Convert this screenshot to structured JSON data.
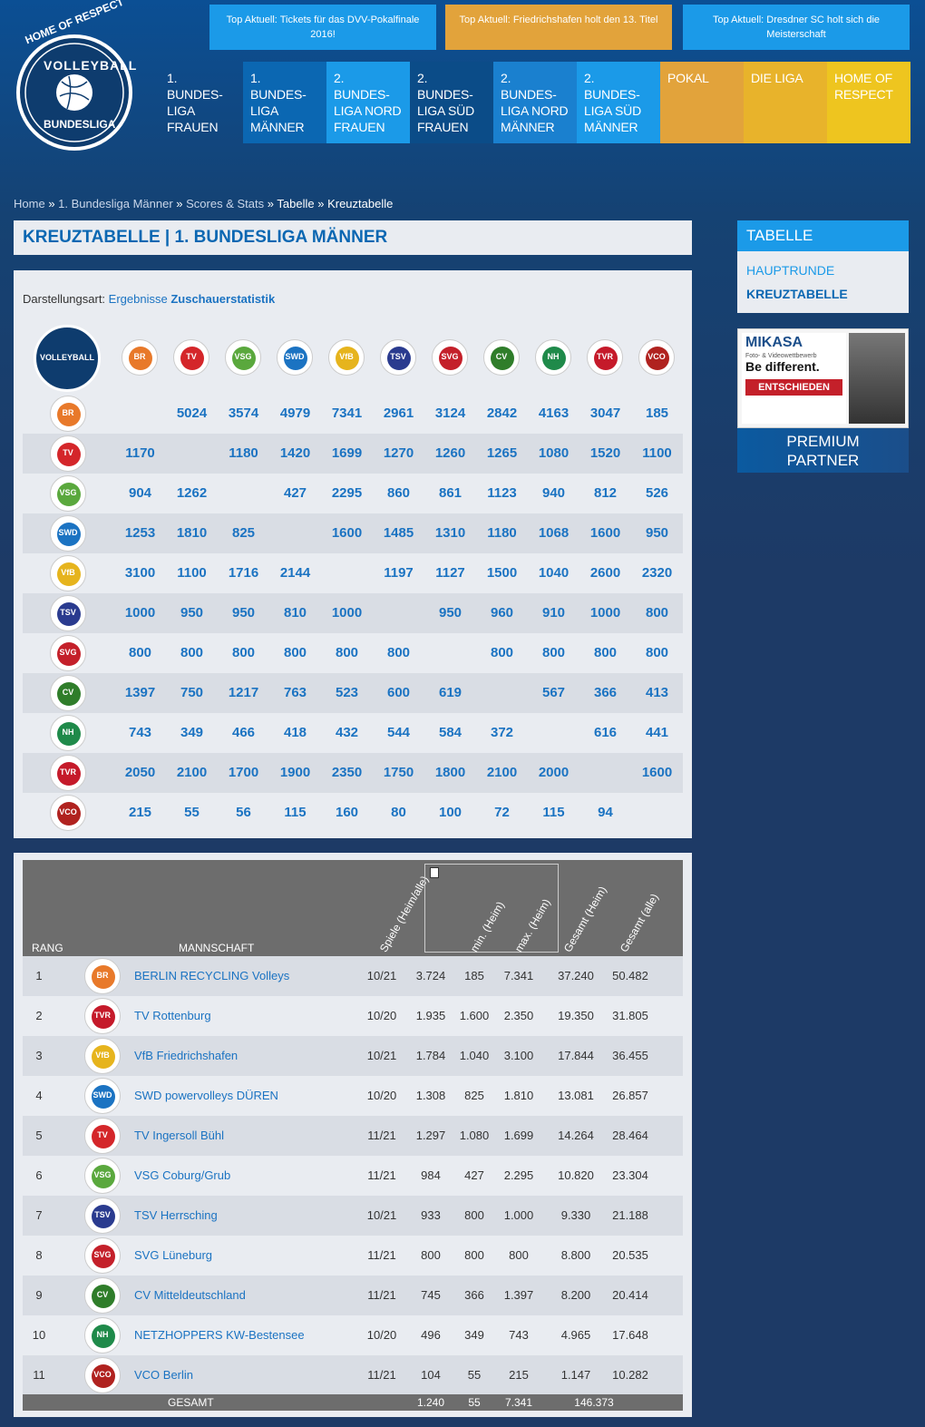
{
  "logo": {
    "top": "HOME OF RESPECT",
    "mid": "VOLLEYBALL",
    "bottom": "BUNDESLIGA"
  },
  "news": [
    {
      "label": "Top Aktuell: Tickets für das DVV-Pokalfinale 2016!",
      "color": "#1b9ae8"
    },
    {
      "label": "Top Aktuell: Friedrichshafen holt den 13. Titel",
      "color": "#e2a33b"
    },
    {
      "label": "Top Aktuell: Dresdner SC holt sich die Meisterschaft",
      "color": "#1b9ae8"
    }
  ],
  "nav": [
    {
      "label": "1. BUNDES-LIGA FRAUEN",
      "color": "transparent"
    },
    {
      "label": "1. BUNDES-LIGA MÄNNER",
      "color": "#0b67b2"
    },
    {
      "label": "2. BUNDES-LIGA NORD FRAUEN",
      "color": "#1b9ae8"
    },
    {
      "label": "2. BUNDES-LIGA SÜD FRAUEN",
      "color": "#0b4c88"
    },
    {
      "label": "2. BUNDES-LIGA NORD MÄNNER",
      "color": "#1a80cf"
    },
    {
      "label": "2. BUNDES-LIGA SÜD MÄNNER",
      "color": "#1b9ae8"
    },
    {
      "label": "POKAL",
      "color": "#e2a33b"
    },
    {
      "label": "DIE LIGA",
      "color": "#e8b32b"
    },
    {
      "label": "HOME OF RESPECT",
      "color": "#eec51f"
    }
  ],
  "breadcrumb": {
    "home": "Home",
    "s1": "»",
    "l1": "1. Bundesliga Männer",
    "l2": "Scores & Stats",
    "l3": "Tabelle",
    "current": "Kreuztabelle"
  },
  "title": "KREUZTABELLE | 1. BUNDESLIGA MÄNNER",
  "sidebar": {
    "head": "TABELLE",
    "items": [
      "HAUPTRUNDE",
      "KREUZTABELLE"
    ]
  },
  "ad": {
    "brand": "MIKASA",
    "line1": "Foto- & Videowettbewerb",
    "line2": "Be different.",
    "btn": "ENTSCHIEDEN",
    "premium1": "PREMIUM",
    "premium2": "PARTNER"
  },
  "darst": {
    "label": "Darstellungsart:",
    "opt1": "Ergebnisse",
    "opt2": "Zuschauerstatistik"
  },
  "teams": [
    {
      "short": "BR",
      "color": "#e8792a"
    },
    {
      "short": "TV",
      "color": "#d4262a"
    },
    {
      "short": "VSG",
      "color": "#5aa83d"
    },
    {
      "short": "SWD",
      "color": "#1b73c2"
    },
    {
      "short": "VfB",
      "color": "#e6b41d"
    },
    {
      "short": "TSV",
      "color": "#2a3b8f"
    },
    {
      "short": "SVG",
      "color": "#c4202a"
    },
    {
      "short": "CV",
      "color": "#2f7d2a"
    },
    {
      "short": "NH",
      "color": "#1f8a4a"
    },
    {
      "short": "TVR",
      "color": "#c51a2a"
    },
    {
      "short": "VCO",
      "color": "#b0221f"
    }
  ],
  "cross": [
    [
      "",
      "5024",
      "3574",
      "4979",
      "7341",
      "2961",
      "3124",
      "2842",
      "4163",
      "3047",
      "185"
    ],
    [
      "1170",
      "",
      "1180",
      "1420",
      "1699",
      "1270",
      "1260",
      "1265",
      "1080",
      "1520",
      "1100"
    ],
    [
      "904",
      "1262",
      "",
      "427",
      "2295",
      "860",
      "861",
      "1123",
      "940",
      "812",
      "526"
    ],
    [
      "1253",
      "1810",
      "825",
      "",
      "1600",
      "1485",
      "1310",
      "1180",
      "1068",
      "1600",
      "950"
    ],
    [
      "3100",
      "1100",
      "1716",
      "2144",
      "",
      "1197",
      "1127",
      "1500",
      "1040",
      "2600",
      "2320"
    ],
    [
      "1000",
      "950",
      "950",
      "810",
      "1000",
      "",
      "950",
      "960",
      "910",
      "1000",
      "800"
    ],
    [
      "800",
      "800",
      "800",
      "800",
      "800",
      "800",
      "",
      "800",
      "800",
      "800",
      "800"
    ],
    [
      "1397",
      "750",
      "1217",
      "763",
      "523",
      "600",
      "619",
      "",
      "567",
      "366",
      "413"
    ],
    [
      "743",
      "349",
      "466",
      "418",
      "432",
      "544",
      "584",
      "372",
      "",
      "616",
      "441"
    ],
    [
      "2050",
      "2100",
      "1700",
      "1900",
      "2350",
      "1750",
      "1800",
      "2100",
      "2000",
      "",
      "1600"
    ],
    [
      "215",
      "55",
      "56",
      "115",
      "160",
      "80",
      "100",
      "72",
      "115",
      "94",
      ""
    ]
  ],
  "rankhead": {
    "rang": "RANG",
    "mannschaft": "MANNSCHAFT",
    "spiele": "Spiele (Heim/alle)",
    "min": "min. (Heim)",
    "max": "max. (Heim)",
    "gesheim": "Gesamt (Heim)",
    "gesalle": "Gesamt (alle)"
  },
  "ranking": [
    {
      "rang": "1",
      "team": 0,
      "name": "BERLIN RECYCLING Volleys",
      "spiele": "10/21",
      "avg": "3.724",
      "min": "185",
      "max": "7.341",
      "gh": "37.240",
      "ga": "50.482"
    },
    {
      "rang": "2",
      "team": 9,
      "name": "TV Rottenburg",
      "spiele": "10/20",
      "avg": "1.935",
      "min": "1.600",
      "max": "2.350",
      "gh": "19.350",
      "ga": "31.805"
    },
    {
      "rang": "3",
      "team": 4,
      "name": "VfB Friedrichshafen",
      "spiele": "10/21",
      "avg": "1.784",
      "min": "1.040",
      "max": "3.100",
      "gh": "17.844",
      "ga": "36.455"
    },
    {
      "rang": "4",
      "team": 3,
      "name": "SWD powervolleys DÜREN",
      "spiele": "10/20",
      "avg": "1.308",
      "min": "825",
      "max": "1.810",
      "gh": "13.081",
      "ga": "26.857"
    },
    {
      "rang": "5",
      "team": 1,
      "name": "TV Ingersoll Bühl",
      "spiele": "11/21",
      "avg": "1.297",
      "min": "1.080",
      "max": "1.699",
      "gh": "14.264",
      "ga": "28.464"
    },
    {
      "rang": "6",
      "team": 2,
      "name": "VSG Coburg/Grub",
      "spiele": "11/21",
      "avg": "984",
      "min": "427",
      "max": "2.295",
      "gh": "10.820",
      "ga": "23.304"
    },
    {
      "rang": "7",
      "team": 5,
      "name": "TSV Herrsching",
      "spiele": "10/21",
      "avg": "933",
      "min": "800",
      "max": "1.000",
      "gh": "9.330",
      "ga": "21.188"
    },
    {
      "rang": "8",
      "team": 6,
      "name": "SVG Lüneburg",
      "spiele": "11/21",
      "avg": "800",
      "min": "800",
      "max": "800",
      "gh": "8.800",
      "ga": "20.535"
    },
    {
      "rang": "9",
      "team": 7,
      "name": "CV Mitteldeutschland",
      "spiele": "11/21",
      "avg": "745",
      "min": "366",
      "max": "1.397",
      "gh": "8.200",
      "ga": "20.414"
    },
    {
      "rang": "10",
      "team": 8,
      "name": "NETZHOPPERS KW-Bestensee",
      "spiele": "10/20",
      "avg": "496",
      "min": "349",
      "max": "743",
      "gh": "4.965",
      "ga": "17.648"
    },
    {
      "rang": "11",
      "team": 10,
      "name": "VCO Berlin",
      "spiele": "11/21",
      "avg": "104",
      "min": "55",
      "max": "215",
      "gh": "1.147",
      "ga": "10.282"
    }
  ],
  "total": {
    "label": "GESAMT",
    "avg": "1.240",
    "min": "55",
    "max": "7.341",
    "ga": "146.373"
  }
}
